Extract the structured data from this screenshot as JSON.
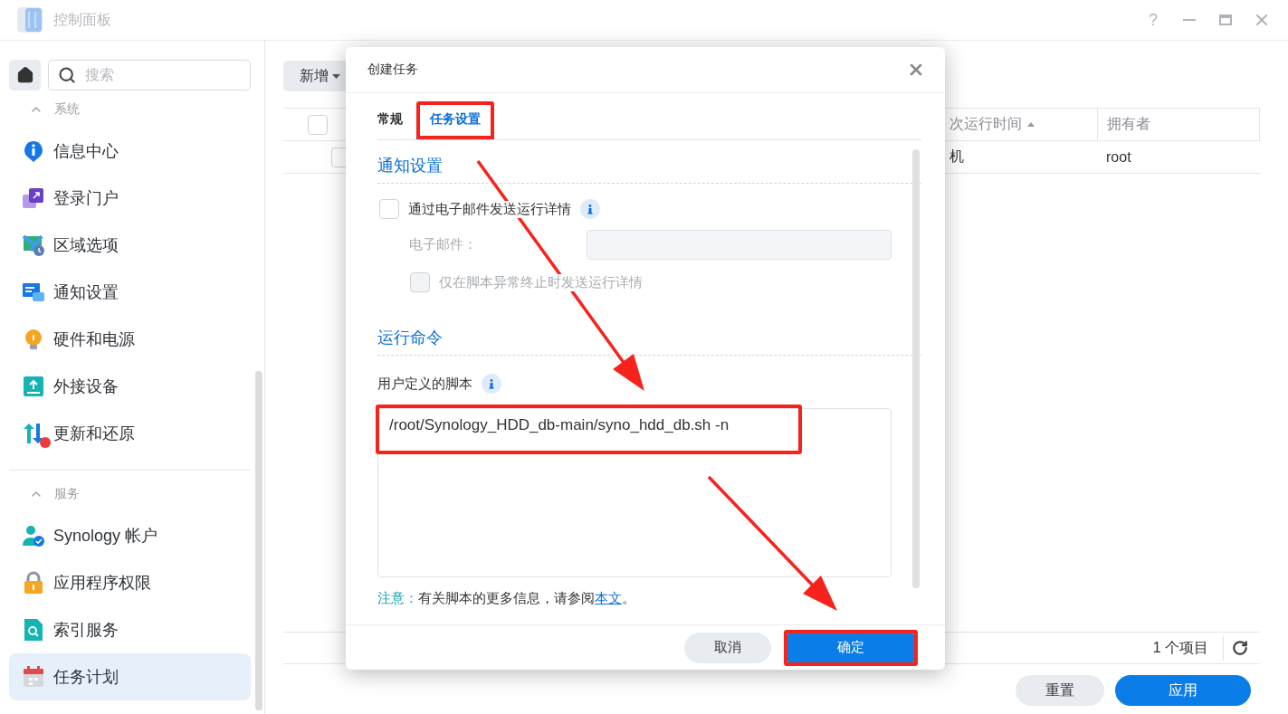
{
  "window": {
    "title": "控制面板",
    "help_label": "?"
  },
  "sidebar": {
    "search": {
      "placeholder": "搜索"
    },
    "sections": [
      {
        "title": "系统",
        "expanded": true,
        "items": [
          {
            "label": "信息中心",
            "selected": false,
            "alert": false
          },
          {
            "label": "登录门户",
            "selected": false,
            "alert": false
          },
          {
            "label": "区域选项",
            "selected": false,
            "alert": false
          },
          {
            "label": "通知设置",
            "selected": false,
            "alert": false
          },
          {
            "label": "硬件和电源",
            "selected": false,
            "alert": false
          },
          {
            "label": "外接设备",
            "selected": false,
            "alert": false
          },
          {
            "label": "更新和还原",
            "selected": false,
            "alert": true
          }
        ]
      },
      {
        "title": "服务",
        "expanded": true,
        "items": [
          {
            "label": "Synology 帐户",
            "selected": false,
            "alert": false
          },
          {
            "label": "应用程序权限",
            "selected": false,
            "alert": false
          },
          {
            "label": "索引服务",
            "selected": false,
            "alert": false
          },
          {
            "label": "任务计划",
            "selected": true,
            "alert": false
          }
        ]
      }
    ]
  },
  "toolbar": {
    "create_button": "新增"
  },
  "table": {
    "header_checked": false,
    "columns": [
      {
        "label": "次运行时间",
        "sorted": true
      },
      {
        "label": "拥有者",
        "sorted": false
      }
    ],
    "rows": [
      {
        "checked": false,
        "cells": [
          "机",
          "root"
        ]
      }
    ]
  },
  "footer": {
    "count": "1 个项目"
  },
  "actions": [
    {
      "label": "重置",
      "primary": false
    },
    {
      "label": "应用",
      "primary": true
    }
  ],
  "dialog": {
    "title": "创建任务",
    "tabs": [
      {
        "label": "常规",
        "selected": false,
        "highlighted": false
      },
      {
        "label": "任务设置",
        "selected": true,
        "highlighted": true
      }
    ],
    "notify": {
      "title": "通知设置",
      "email_option": {
        "label": "通过电子邮件发送运行详情",
        "checked": false
      },
      "email_field": {
        "label": "电子邮件：",
        "disabled": true
      },
      "abnormal_option": {
        "label": "仅在脚本异常终止时发送运行详情",
        "checked": false,
        "disabled": true
      }
    },
    "command": {
      "title": "运行命令",
      "script_label": "用户定义的脚本",
      "script": "/root/Synology_HDD_db-main/syno_hdd_db.sh -n",
      "highlighted": true
    },
    "note": {
      "label": "注意：",
      "text": "有关脚本的更多信息，请参阅",
      "link": "本文",
      "end": "。"
    },
    "buttons": [
      {
        "label": "取消",
        "primary": false,
        "highlighted": false
      },
      {
        "label": "确定",
        "primary": true,
        "highlighted": true
      }
    ]
  }
}
